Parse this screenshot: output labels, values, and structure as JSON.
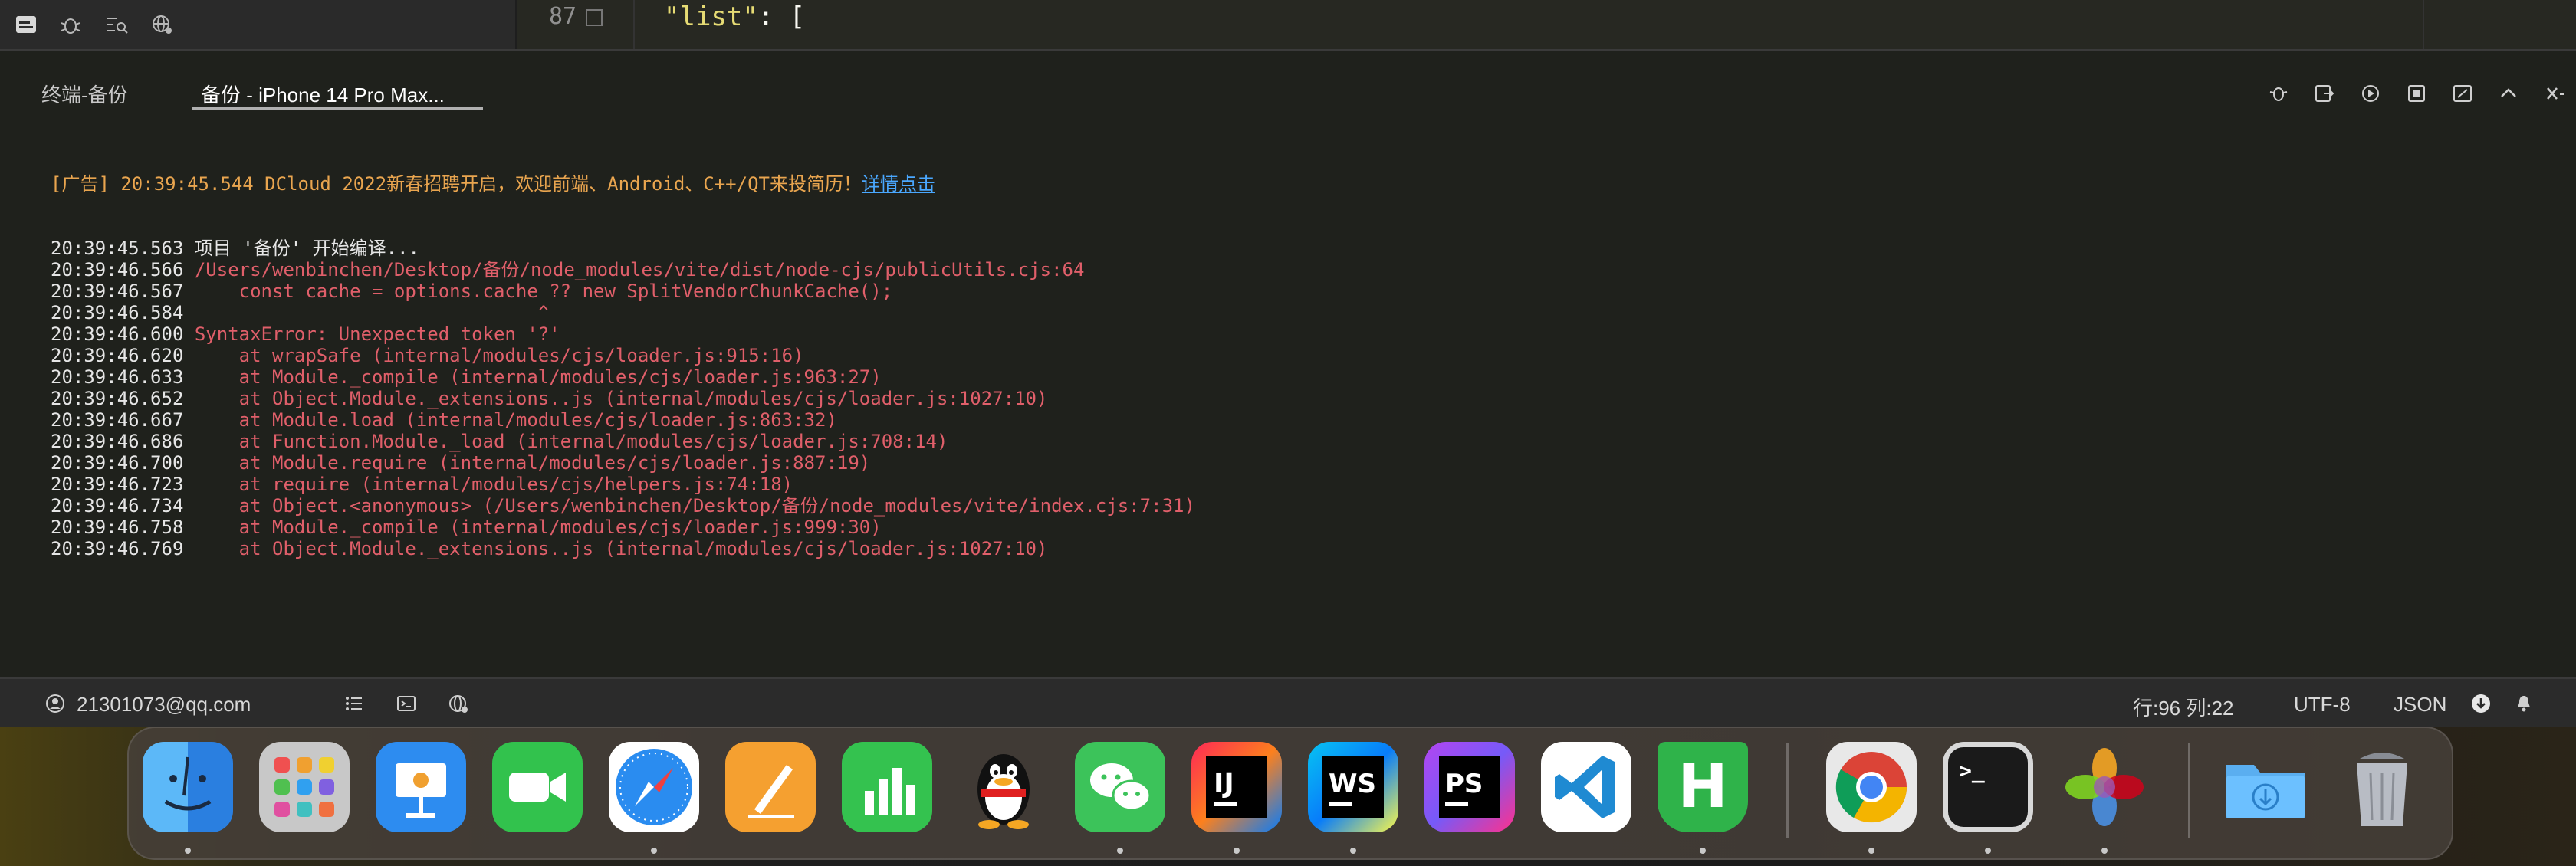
{
  "editor": {
    "line_number": "87",
    "code_key": "\"list\"",
    "code_rest": ": ["
  },
  "panel": {
    "tabs": [
      {
        "label": "终端-备份"
      },
      {
        "label": "备份 - iPhone 14 Pro Max..."
      }
    ]
  },
  "console": {
    "ad": {
      "prefix": "[广告] 20:39:45.544 DCloud 2022新春招聘开启，欢迎前端、Android、C++/QT来投简历！",
      "link": "详情点击"
    },
    "lines": [
      {
        "ts": "20:39:45.563 ",
        "text": "项目 '备份' 开始编译...",
        "type": "norm"
      },
      {
        "ts": "20:39:46.566 ",
        "text": "/Users/wenbinchen/Desktop/备份/node_modules/vite/dist/node-cjs/publicUtils.cjs:64",
        "type": "err"
      },
      {
        "ts": "20:39:46.567 ",
        "text": "    const cache = options.cache ?? new SplitVendorChunkCache();",
        "type": "err"
      },
      {
        "ts": "20:39:46.584 ",
        "text": "                               ^",
        "type": "err"
      },
      {
        "ts": "20:39:46.600 ",
        "text": "SyntaxError: Unexpected token '?'",
        "type": "err"
      },
      {
        "ts": "20:39:46.620 ",
        "text": "    at wrapSafe (internal/modules/cjs/loader.js:915:16)",
        "type": "err"
      },
      {
        "ts": "20:39:46.633 ",
        "text": "    at Module._compile (internal/modules/cjs/loader.js:963:27)",
        "type": "err"
      },
      {
        "ts": "20:39:46.652 ",
        "text": "    at Object.Module._extensions..js (internal/modules/cjs/loader.js:1027:10)",
        "type": "err"
      },
      {
        "ts": "20:39:46.667 ",
        "text": "    at Module.load (internal/modules/cjs/loader.js:863:32)",
        "type": "err"
      },
      {
        "ts": "20:39:46.686 ",
        "text": "    at Function.Module._load (internal/modules/cjs/loader.js:708:14)",
        "type": "err"
      },
      {
        "ts": "20:39:46.700 ",
        "text": "    at Module.require (internal/modules/cjs/loader.js:887:19)",
        "type": "err"
      },
      {
        "ts": "20:39:46.723 ",
        "text": "    at require (internal/modules/cjs/helpers.js:74:18)",
        "type": "err"
      },
      {
        "ts": "20:39:46.734 ",
        "text": "    at Object.<anonymous> (/Users/wenbinchen/Desktop/备份/node_modules/vite/index.cjs:7:31)",
        "type": "err"
      },
      {
        "ts": "20:39:46.758 ",
        "text": "    at Module._compile (internal/modules/cjs/loader.js:999:30)",
        "type": "err"
      },
      {
        "ts": "20:39:46.769 ",
        "text": "    at Object.Module._extensions..js (internal/modules/cjs/loader.js:1027:10)",
        "type": "err"
      }
    ]
  },
  "status": {
    "account": "21301073@qq.com",
    "position": "行:96  列:22",
    "encoding": "UTF-8",
    "language": "JSON"
  },
  "dock": {
    "apps": [
      {
        "name": "finder",
        "icon": "finder-icon"
      },
      {
        "name": "launchpad",
        "icon": "launchpad-icon"
      },
      {
        "name": "keynote",
        "icon": "keynote-icon"
      },
      {
        "name": "facetime",
        "icon": "facetime-icon"
      },
      {
        "name": "safari",
        "icon": "safari-icon"
      },
      {
        "name": "pages",
        "icon": "pages-icon"
      },
      {
        "name": "numbers",
        "icon": "numbers-icon"
      },
      {
        "name": "qq",
        "icon": "qq-penguin-icon"
      },
      {
        "name": "wechat",
        "icon": "wechat-icon"
      },
      {
        "name": "intellij",
        "icon": "intellij-icon",
        "label": "IJ"
      },
      {
        "name": "webstorm",
        "icon": "webstorm-icon",
        "label": "WS"
      },
      {
        "name": "phpstorm",
        "icon": "phpstorm-icon",
        "label": "PS"
      },
      {
        "name": "vscode",
        "icon": "vscode-icon"
      },
      {
        "name": "hbuilderx",
        "icon": "hbuilderx-icon",
        "label": "H"
      },
      {
        "name": "chrome",
        "icon": "chrome-icon"
      },
      {
        "name": "terminal",
        "icon": "terminal-icon",
        "label": ">_"
      },
      {
        "name": "photos",
        "icon": "photos-icon"
      },
      {
        "name": "downloads",
        "icon": "downloads-folder-icon"
      },
      {
        "name": "trash",
        "icon": "trash-icon"
      }
    ]
  }
}
